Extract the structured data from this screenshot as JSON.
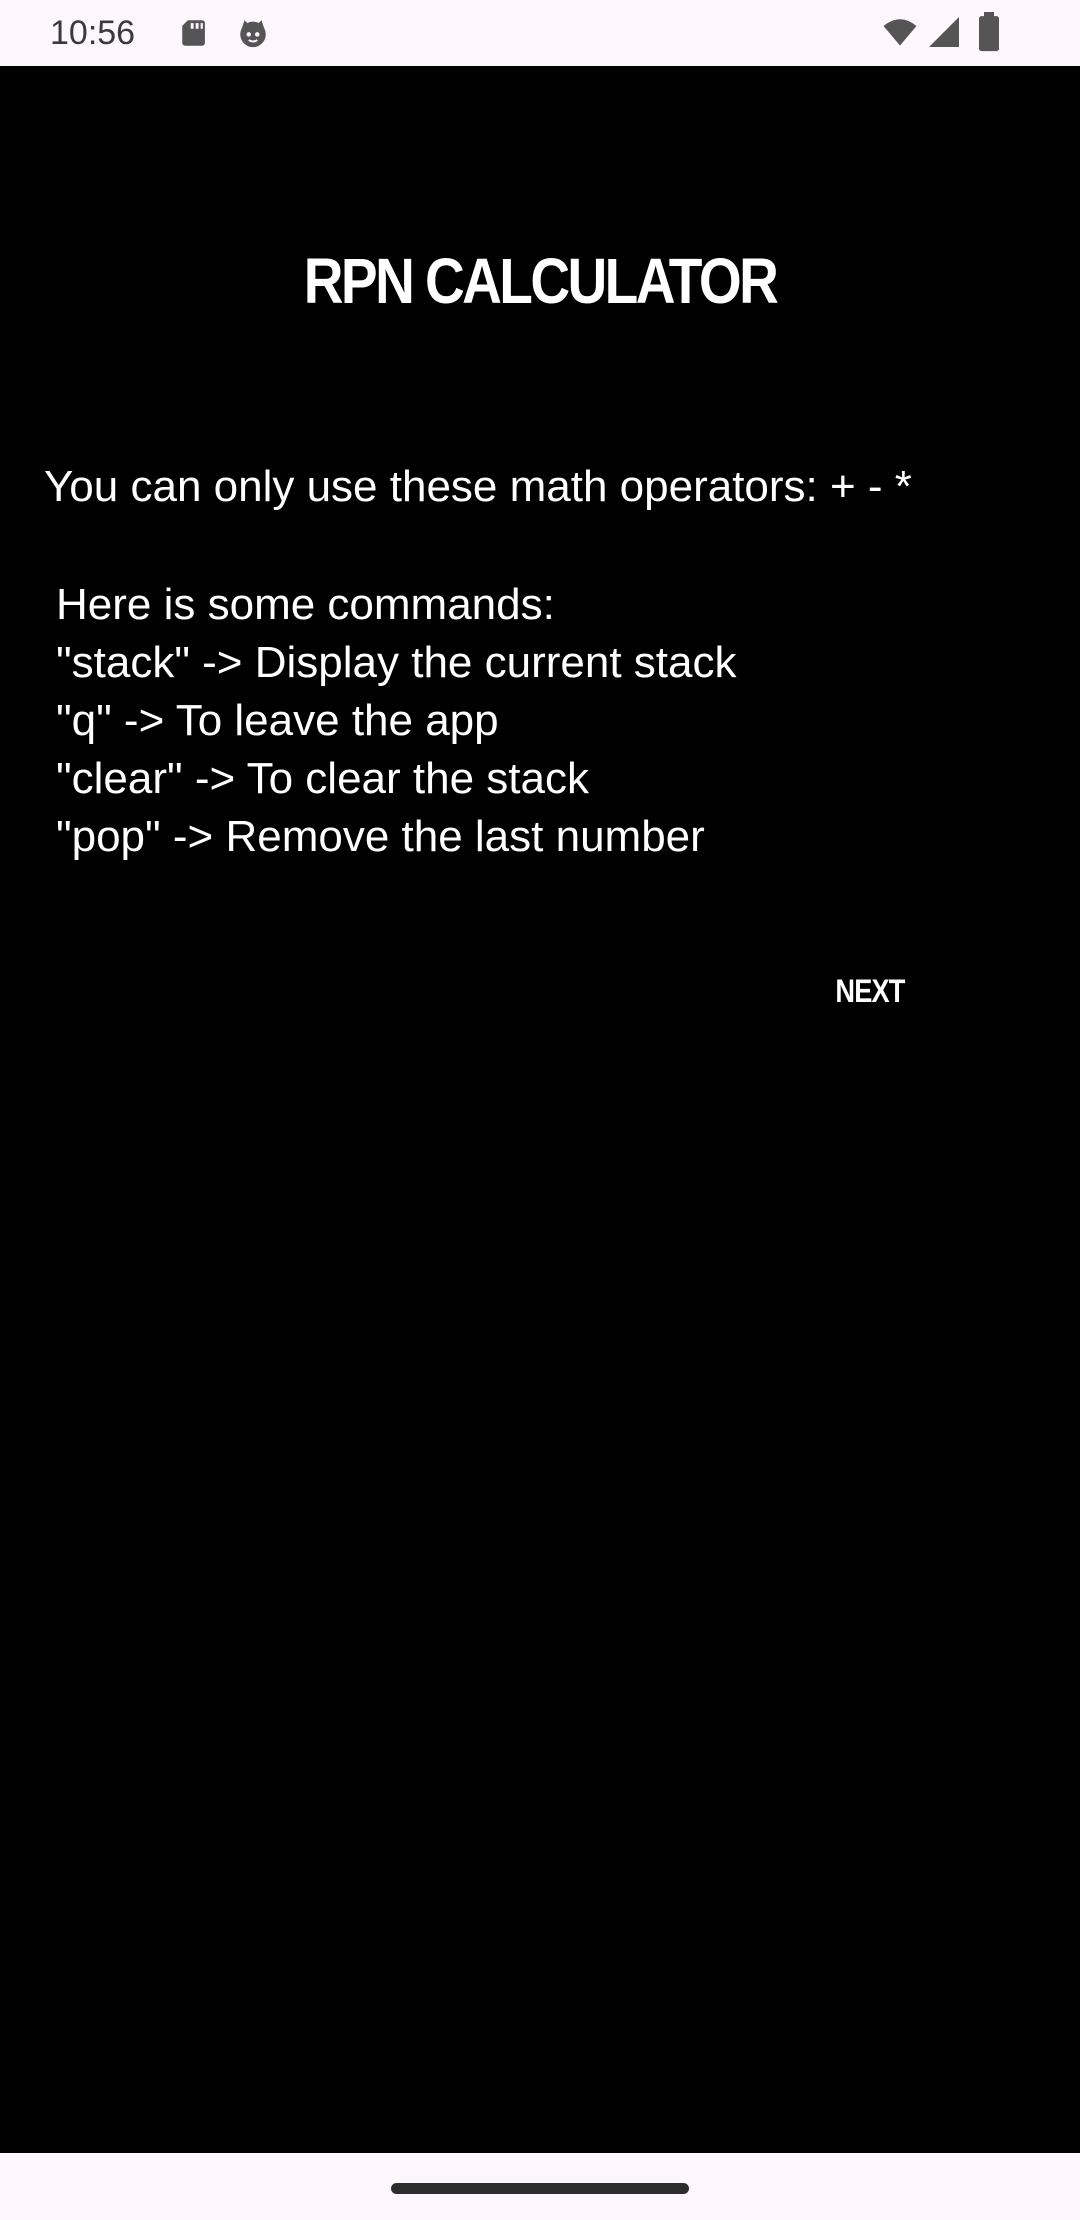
{
  "status_bar": {
    "time": "10:56",
    "icons": [
      "sd-card-icon",
      "cat-face-icon",
      "wifi-icon",
      "signal-icon",
      "battery-icon"
    ]
  },
  "app": {
    "title": "RPN CALCULATOR",
    "operators_text": "You can only use these math operators: + - *",
    "commands_header": "Here is some commands:",
    "commands": [
      "\"stack\" -> Display the current stack",
      "\"q\" -> To leave the app",
      "\"clear\" -> To clear the stack",
      "\"pop\" -> Remove the last number"
    ],
    "next_label": "NEXT"
  },
  "colors": {
    "background": "#000000",
    "text": "#ffffff",
    "system_bar": "#fdf7fd"
  }
}
